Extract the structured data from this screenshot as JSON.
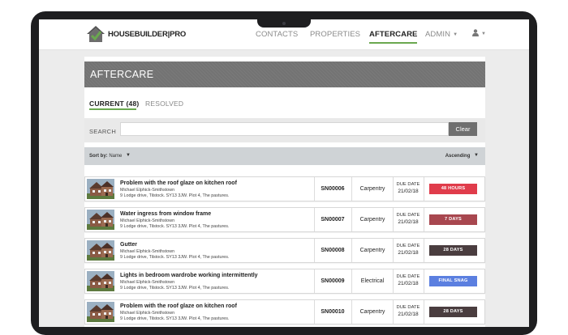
{
  "app": {
    "logo_text": "HOUSEBUILDER|PRO",
    "nav": [
      {
        "label": "CONTACTS",
        "active": false
      },
      {
        "label": "PROPERTIES",
        "active": false
      },
      {
        "label": "AFTERCARE",
        "active": true
      },
      {
        "label": "ADMIN",
        "active": false
      }
    ],
    "user_menu_icon": "user-icon"
  },
  "page": {
    "title": "AFTERCARE",
    "tabs": [
      {
        "label": "CURRENT (48)",
        "active": true
      },
      {
        "label": "RESOLVED",
        "active": false
      }
    ],
    "search": {
      "label": "SEARCH",
      "value": "",
      "placeholder": "",
      "button_label": "Clear"
    },
    "sort": {
      "prefix": "Sort by:",
      "field": "Name",
      "order": "Ascending"
    }
  },
  "snags": [
    {
      "title": "Problem with the roof glaze on kitchen roof",
      "customer": "Michael Elphick-Smithstown",
      "address": "9 Lodge drive, Tilstock. SY13 3JW. Plot 4, The pastures.",
      "ref": "SN00006",
      "trade": "Carpentry",
      "due_label": "DUE DATE",
      "due_date": "21/02/18",
      "status": "48 HOURS",
      "status_color": "#e03c4b"
    },
    {
      "title": "Water ingress from window frame",
      "customer": "Michael Elphick-Smithstown",
      "address": "9 Lodge drive, Tilstock. SY13 3JW. Plot 4, The pastures.",
      "ref": "SN00007",
      "trade": "Carpentry",
      "due_label": "DUE DATE",
      "due_date": "21/02/18",
      "status": "7 DAYS",
      "status_color": "#a8474f"
    },
    {
      "title": "Gutter",
      "customer": "Michael Elphick-Smithstown",
      "address": "9 Lodge drive, Tilstock. SY13 3JW. Plot 4, The pastures.",
      "ref": "SN00008",
      "trade": "Carpentry",
      "due_label": "DUE DATE",
      "due_date": "21/02/18",
      "status": "28 DAYS",
      "status_color": "#4a3d3f"
    },
    {
      "title": "Lights in bedroom wardrobe working intermittently",
      "customer": "Michael Elphick-Smithstown",
      "address": "9 Lodge drive, Tilstock. SY13 3JW. Plot 4, The pastures.",
      "ref": "SN00009",
      "trade": "Electrical",
      "due_label": "DUE DATE",
      "due_date": "21/02/18",
      "status": "FINAL SNAG",
      "status_color": "#5b7fe0"
    },
    {
      "title": "Problem with the roof glaze on kitchen roof",
      "customer": "Michael Elphick-Smithstown",
      "address": "9 Lodge drive, Tilstock. SY13 3JW. Plot 4, The pastures.",
      "ref": "SN00010",
      "trade": "Carpentry",
      "due_label": "DUE DATE",
      "due_date": "21/02/18",
      "status": "28 DAYS",
      "status_color": "#4a3d3f"
    }
  ]
}
